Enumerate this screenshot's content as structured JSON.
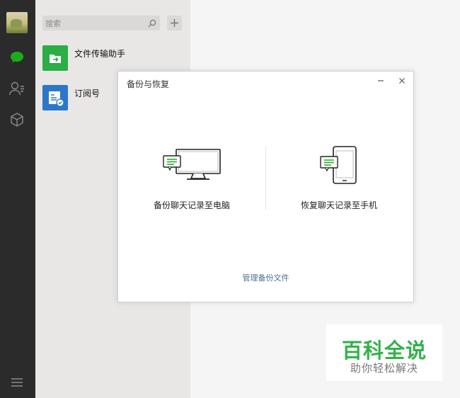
{
  "search": {
    "placeholder": "搜索"
  },
  "chats": [
    {
      "name": "文件传输助手",
      "icon": "folder-transfer-icon",
      "color": "#2aae45"
    },
    {
      "name": "订阅号",
      "icon": "subscription-icon",
      "color": "#2b78c8"
    }
  ],
  "dialog": {
    "title": "备份与恢复",
    "backup_label": "备份聊天记录至电脑",
    "restore_label": "恢复聊天记录至手机",
    "manage_link": "管理备份文件"
  },
  "watermark": {
    "title": "百科全说",
    "subtitle": "助你轻松解决"
  },
  "colors": {
    "accent": "#1aad19",
    "sidebar": "#2b2b2b",
    "link": "#4f6e93"
  }
}
